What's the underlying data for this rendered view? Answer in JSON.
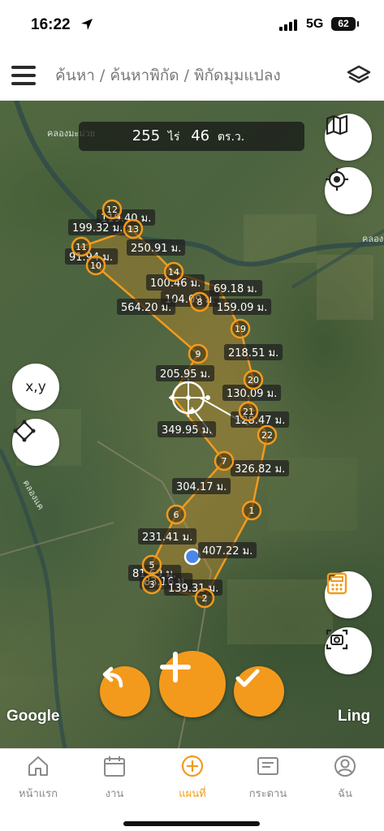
{
  "status_bar": {
    "time": "16:22",
    "network": "5G",
    "battery": "62"
  },
  "header": {
    "breadcrumb": [
      "ค้นหา",
      "ค้นหาพิกัด",
      "พิกัดมุมแปลง"
    ],
    "separator": "/"
  },
  "map": {
    "area": {
      "rai_value": "255",
      "rai_unit": "ไร่",
      "sqwa_value": "46",
      "sqwa_unit": "ตร.ว."
    },
    "xy_button": "x,y",
    "providers": {
      "google": "Google",
      "ling": "Ling"
    },
    "place_labels": [
      "คลองมะม่วย",
      "คลอง",
      "คลองแค"
    ],
    "points": [
      "12",
      "13",
      "11",
      "10",
      "14",
      "8",
      "19",
      "9",
      "20",
      "21",
      "22",
      "7",
      "1",
      "6",
      "5",
      "3",
      "2"
    ],
    "distances": [
      "119.40 ม.",
      "199.32 ม.",
      "250.91 ม.",
      "91.94 ม.",
      "100.46 ม.",
      "104.09 ม.",
      "69.18 ม.",
      "564.20 ม.",
      "159.09 ม.",
      "218.51 ม.",
      "205.95 ม.",
      "130.09 ม.",
      "128.47 ม.",
      "349.95 ม.",
      "326.82 ม.",
      "304.17 ม.",
      "231.41 ม.",
      "407.22 ม.",
      "81.69 ม.",
      "83.16 ม.",
      "139.31 ม."
    ],
    "colors": {
      "accent": "#f39a1d",
      "label_bg": "#1e1e1e"
    }
  },
  "bottom_nav": {
    "items": [
      {
        "label": "หน้าแรก",
        "icon": "home-icon"
      },
      {
        "label": "งาน",
        "icon": "calendar-icon"
      },
      {
        "label": "แผนที่",
        "icon": "plus-circle-icon",
        "active": true
      },
      {
        "label": "กระดาน",
        "icon": "board-icon"
      },
      {
        "label": "ฉัน",
        "icon": "profile-icon"
      }
    ]
  }
}
